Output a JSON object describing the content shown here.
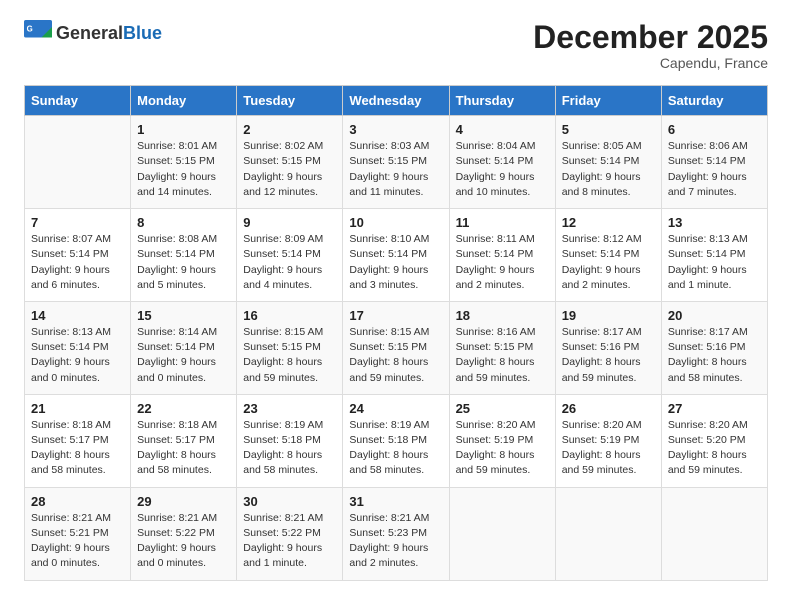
{
  "logo": {
    "text_general": "General",
    "text_blue": "Blue"
  },
  "title": "December 2025",
  "subtitle": "Capendu, France",
  "headers": [
    "Sunday",
    "Monday",
    "Tuesday",
    "Wednesday",
    "Thursday",
    "Friday",
    "Saturday"
  ],
  "weeks": [
    [
      {
        "day": "",
        "sunrise": "",
        "sunset": "",
        "daylight": ""
      },
      {
        "day": "1",
        "sunrise": "Sunrise: 8:01 AM",
        "sunset": "Sunset: 5:15 PM",
        "daylight": "Daylight: 9 hours and 14 minutes."
      },
      {
        "day": "2",
        "sunrise": "Sunrise: 8:02 AM",
        "sunset": "Sunset: 5:15 PM",
        "daylight": "Daylight: 9 hours and 12 minutes."
      },
      {
        "day": "3",
        "sunrise": "Sunrise: 8:03 AM",
        "sunset": "Sunset: 5:15 PM",
        "daylight": "Daylight: 9 hours and 11 minutes."
      },
      {
        "day": "4",
        "sunrise": "Sunrise: 8:04 AM",
        "sunset": "Sunset: 5:14 PM",
        "daylight": "Daylight: 9 hours and 10 minutes."
      },
      {
        "day": "5",
        "sunrise": "Sunrise: 8:05 AM",
        "sunset": "Sunset: 5:14 PM",
        "daylight": "Daylight: 9 hours and 8 minutes."
      },
      {
        "day": "6",
        "sunrise": "Sunrise: 8:06 AM",
        "sunset": "Sunset: 5:14 PM",
        "daylight": "Daylight: 9 hours and 7 minutes."
      }
    ],
    [
      {
        "day": "7",
        "sunrise": "Sunrise: 8:07 AM",
        "sunset": "Sunset: 5:14 PM",
        "daylight": "Daylight: 9 hours and 6 minutes."
      },
      {
        "day": "8",
        "sunrise": "Sunrise: 8:08 AM",
        "sunset": "Sunset: 5:14 PM",
        "daylight": "Daylight: 9 hours and 5 minutes."
      },
      {
        "day": "9",
        "sunrise": "Sunrise: 8:09 AM",
        "sunset": "Sunset: 5:14 PM",
        "daylight": "Daylight: 9 hours and 4 minutes."
      },
      {
        "day": "10",
        "sunrise": "Sunrise: 8:10 AM",
        "sunset": "Sunset: 5:14 PM",
        "daylight": "Daylight: 9 hours and 3 minutes."
      },
      {
        "day": "11",
        "sunrise": "Sunrise: 8:11 AM",
        "sunset": "Sunset: 5:14 PM",
        "daylight": "Daylight: 9 hours and 2 minutes."
      },
      {
        "day": "12",
        "sunrise": "Sunrise: 8:12 AM",
        "sunset": "Sunset: 5:14 PM",
        "daylight": "Daylight: 9 hours and 2 minutes."
      },
      {
        "day": "13",
        "sunrise": "Sunrise: 8:13 AM",
        "sunset": "Sunset: 5:14 PM",
        "daylight": "Daylight: 9 hours and 1 minute."
      }
    ],
    [
      {
        "day": "14",
        "sunrise": "Sunrise: 8:13 AM",
        "sunset": "Sunset: 5:14 PM",
        "daylight": "Daylight: 9 hours and 0 minutes."
      },
      {
        "day": "15",
        "sunrise": "Sunrise: 8:14 AM",
        "sunset": "Sunset: 5:14 PM",
        "daylight": "Daylight: 9 hours and 0 minutes."
      },
      {
        "day": "16",
        "sunrise": "Sunrise: 8:15 AM",
        "sunset": "Sunset: 5:15 PM",
        "daylight": "Daylight: 8 hours and 59 minutes."
      },
      {
        "day": "17",
        "sunrise": "Sunrise: 8:15 AM",
        "sunset": "Sunset: 5:15 PM",
        "daylight": "Daylight: 8 hours and 59 minutes."
      },
      {
        "day": "18",
        "sunrise": "Sunrise: 8:16 AM",
        "sunset": "Sunset: 5:15 PM",
        "daylight": "Daylight: 8 hours and 59 minutes."
      },
      {
        "day": "19",
        "sunrise": "Sunrise: 8:17 AM",
        "sunset": "Sunset: 5:16 PM",
        "daylight": "Daylight: 8 hours and 59 minutes."
      },
      {
        "day": "20",
        "sunrise": "Sunrise: 8:17 AM",
        "sunset": "Sunset: 5:16 PM",
        "daylight": "Daylight: 8 hours and 58 minutes."
      }
    ],
    [
      {
        "day": "21",
        "sunrise": "Sunrise: 8:18 AM",
        "sunset": "Sunset: 5:17 PM",
        "daylight": "Daylight: 8 hours and 58 minutes."
      },
      {
        "day": "22",
        "sunrise": "Sunrise: 8:18 AM",
        "sunset": "Sunset: 5:17 PM",
        "daylight": "Daylight: 8 hours and 58 minutes."
      },
      {
        "day": "23",
        "sunrise": "Sunrise: 8:19 AM",
        "sunset": "Sunset: 5:18 PM",
        "daylight": "Daylight: 8 hours and 58 minutes."
      },
      {
        "day": "24",
        "sunrise": "Sunrise: 8:19 AM",
        "sunset": "Sunset: 5:18 PM",
        "daylight": "Daylight: 8 hours and 58 minutes."
      },
      {
        "day": "25",
        "sunrise": "Sunrise: 8:20 AM",
        "sunset": "Sunset: 5:19 PM",
        "daylight": "Daylight: 8 hours and 59 minutes."
      },
      {
        "day": "26",
        "sunrise": "Sunrise: 8:20 AM",
        "sunset": "Sunset: 5:19 PM",
        "daylight": "Daylight: 8 hours and 59 minutes."
      },
      {
        "day": "27",
        "sunrise": "Sunrise: 8:20 AM",
        "sunset": "Sunset: 5:20 PM",
        "daylight": "Daylight: 8 hours and 59 minutes."
      }
    ],
    [
      {
        "day": "28",
        "sunrise": "Sunrise: 8:21 AM",
        "sunset": "Sunset: 5:21 PM",
        "daylight": "Daylight: 9 hours and 0 minutes."
      },
      {
        "day": "29",
        "sunrise": "Sunrise: 8:21 AM",
        "sunset": "Sunset: 5:22 PM",
        "daylight": "Daylight: 9 hours and 0 minutes."
      },
      {
        "day": "30",
        "sunrise": "Sunrise: 8:21 AM",
        "sunset": "Sunset: 5:22 PM",
        "daylight": "Daylight: 9 hours and 1 minute."
      },
      {
        "day": "31",
        "sunrise": "Sunrise: 8:21 AM",
        "sunset": "Sunset: 5:23 PM",
        "daylight": "Daylight: 9 hours and 2 minutes."
      },
      {
        "day": "",
        "sunrise": "",
        "sunset": "",
        "daylight": ""
      },
      {
        "day": "",
        "sunrise": "",
        "sunset": "",
        "daylight": ""
      },
      {
        "day": "",
        "sunrise": "",
        "sunset": "",
        "daylight": ""
      }
    ]
  ]
}
